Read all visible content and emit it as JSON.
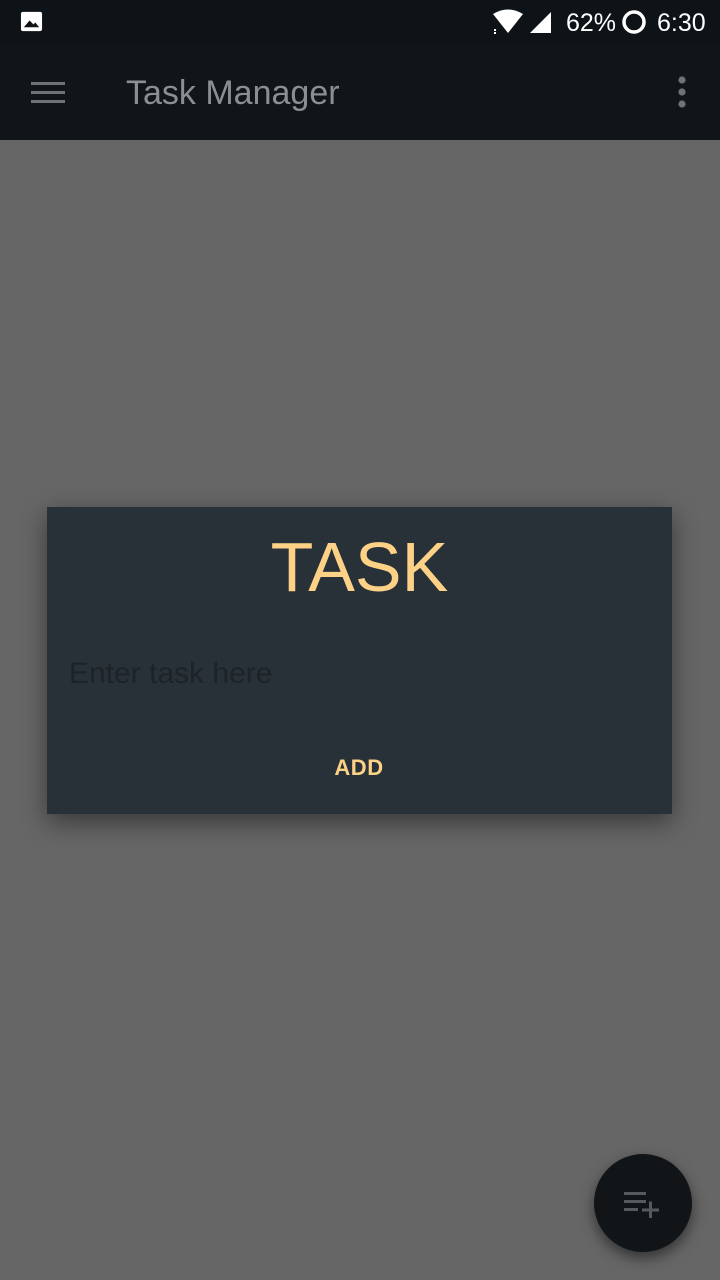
{
  "status_bar": {
    "battery_percent": "62%",
    "time": "6:30",
    "icons": [
      "gallery-notification-icon",
      "wifi-icon",
      "signal-icon",
      "battery-saver-ring-icon"
    ]
  },
  "app_bar": {
    "title": "Task Manager",
    "icons": [
      "menu-icon",
      "overflow-menu-icon"
    ]
  },
  "dialog": {
    "title": "TASK",
    "input_placeholder": "Enter task here",
    "input_value": "",
    "add_label": "ADD"
  },
  "fab": {
    "icon": "playlist-add-icon"
  },
  "colors": {
    "accent": "#fdd287",
    "dialog_bg": "#283138",
    "app_bar_bg": "#101519",
    "scrim_bg": "#666666"
  }
}
